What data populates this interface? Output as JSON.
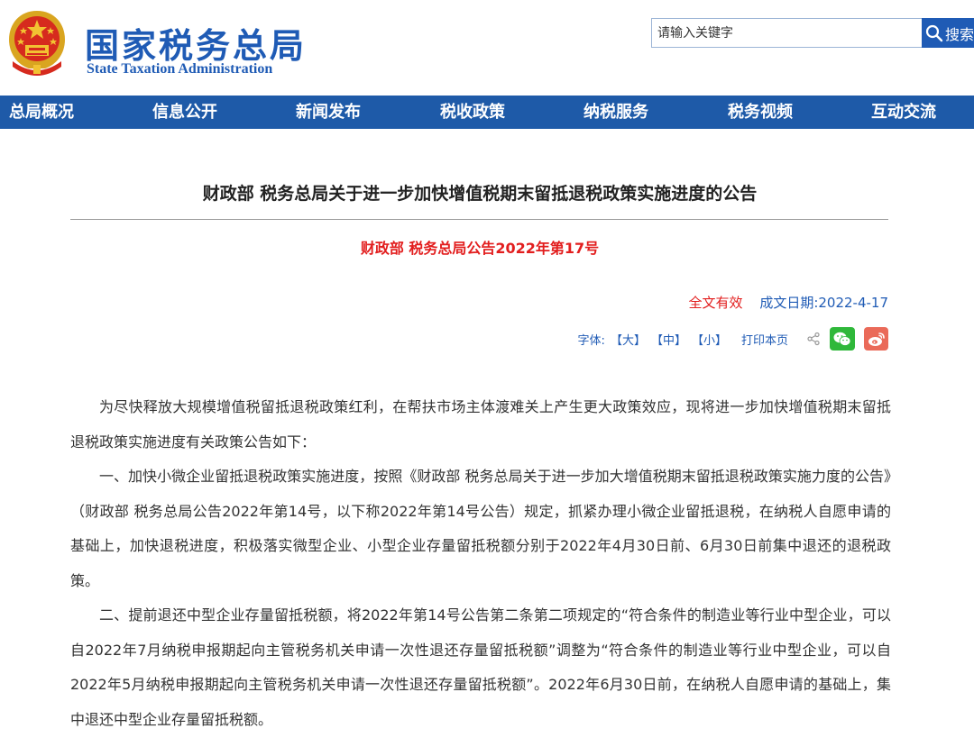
{
  "header": {
    "logo_cn": "国家税务总局",
    "logo_en": "State Taxation Administration",
    "search_placeholder": "请输入关键字",
    "search_button": "搜索"
  },
  "nav": [
    {
      "label": "总局概况"
    },
    {
      "label": "信息公开"
    },
    {
      "label": "新闻发布"
    },
    {
      "label": "税收政策"
    },
    {
      "label": "纳税服务"
    },
    {
      "label": "税务视频"
    },
    {
      "label": "互动交流"
    }
  ],
  "article": {
    "title": "财政部 税务总局关于进一步加快增值税期末留抵退税政策实施进度的公告",
    "doc_number": "财政部 税务总局公告2022年第17号",
    "validity": "全文有效",
    "date": "成文日期:2022-4-17",
    "font_label": "字体:",
    "font_large": "【大】",
    "font_medium": "【中】",
    "font_small": "【小】",
    "print": "打印本页",
    "paragraphs": [
      "为尽快释放大规模增值税留抵退税政策红利，在帮扶市场主体渡难关上产生更大政策效应，现将进一步加快增值税期末留抵退税政策实施进度有关政策公告如下：",
      "一、加快小微企业留抵退税政策实施进度，按照《财政部 税务总局关于进一步加大增值税期末留抵退税政策实施力度的公告》（财政部 税务总局公告2022年第14号，以下称2022年第14号公告）规定，抓紧办理小微企业留抵退税，在纳税人自愿申请的基础上，加快退税进度，积极落实微型企业、小型企业存量留抵税额分别于2022年4月30日前、6月30日前集中退还的退税政策。",
      "二、提前退还中型企业存量留抵税额，将2022年第14号公告第二条第二项规定的“符合条件的制造业等行业中型企业，可以自2022年7月纳税申报期起向主管税务机关申请一次性退还存量留抵税额”调整为“符合条件的制造业等行业中型企业，可以自2022年5月纳税申报期起向主管税务机关申请一次性退还存量留抵税额”。2022年6月30日前，在纳税人自愿申请的基础上，集中退还中型企业存量留抵税额。"
    ]
  },
  "colors": {
    "brand_blue": "#1f5bb5",
    "nav_bg": "#1e5aa8",
    "accent_red": "#e21d1d",
    "wechat_green": "#2fb83a",
    "weibo_red": "#ea6a59"
  },
  "icons": {
    "emblem": "national-emblem-icon",
    "search": "search-icon",
    "share": "share-icon",
    "wechat": "wechat-icon",
    "weibo": "weibo-icon"
  }
}
